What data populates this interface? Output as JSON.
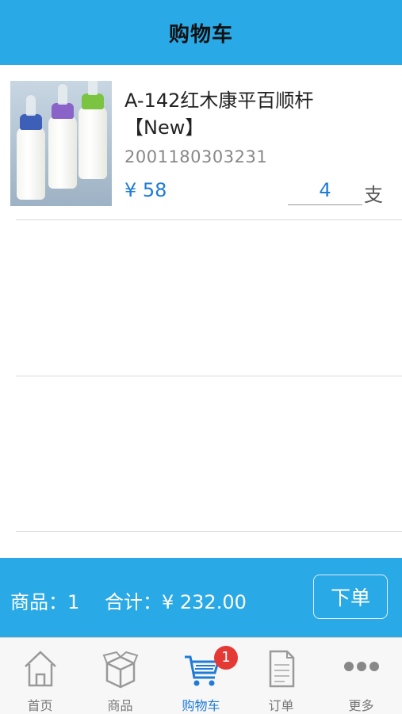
{
  "header": {
    "title": "购物车"
  },
  "cart": {
    "items": [
      {
        "name": "A-142红木康平百顺杆【New】",
        "code": "2001180303231",
        "price": "¥ 58",
        "quantity": "4",
        "unit": "支"
      }
    ]
  },
  "footer": {
    "count_text": "商品：1",
    "total_text": "合计：¥ 232.00",
    "order_label": "下单"
  },
  "tabbar": {
    "tabs": [
      {
        "label": "首页",
        "icon": "home-icon"
      },
      {
        "label": "商品",
        "icon": "box-icon"
      },
      {
        "label": "购物车",
        "icon": "cart-icon",
        "badge": "1"
      },
      {
        "label": "订单",
        "icon": "document-icon"
      },
      {
        "label": "更多",
        "icon": "more-icon"
      }
    ]
  },
  "colors": {
    "primary": "#29a9e6",
    "accent_text": "#1e7bd6",
    "badge": "#e53935"
  }
}
